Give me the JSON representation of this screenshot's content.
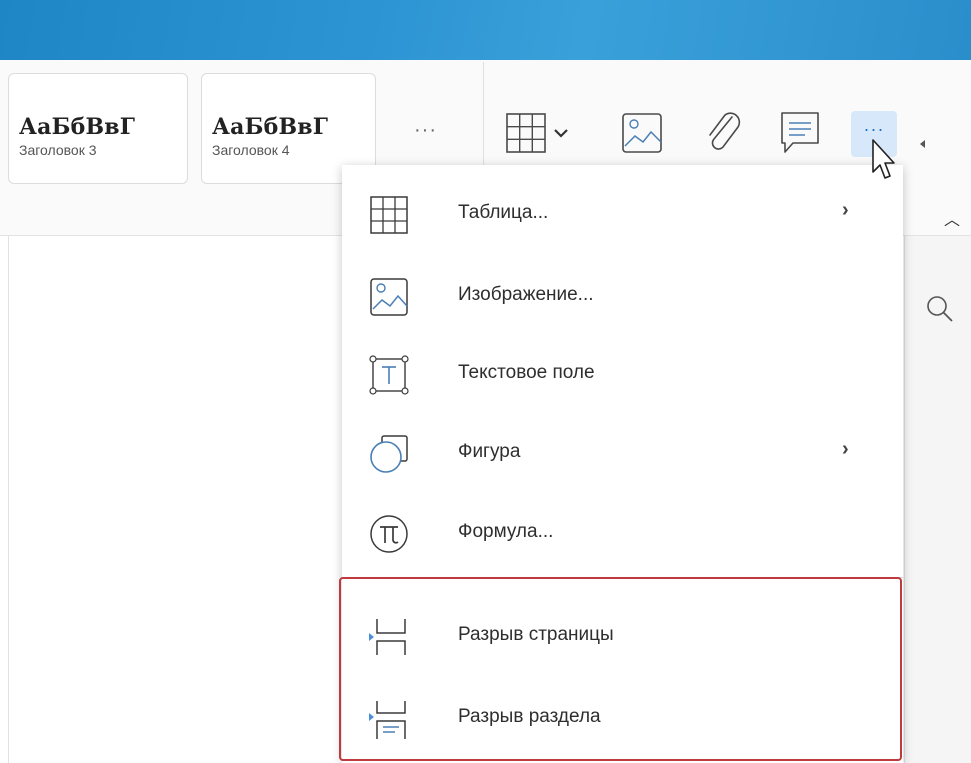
{
  "styles": [
    {
      "sample": "АаБбВвГ",
      "name": "Заголовок 3"
    },
    {
      "sample": "АаБбВвГ",
      "name": "Заголовок 4"
    }
  ],
  "toolbar": {
    "more_styles_label": "···",
    "more_label": "···",
    "icons": [
      "table-icon",
      "image-icon",
      "link-icon",
      "comment-icon",
      "more-icon"
    ]
  },
  "menu": {
    "items": [
      {
        "label": "Таблица...",
        "icon": "table-icon",
        "submenu": true
      },
      {
        "label": "Изображение...",
        "icon": "image-icon",
        "submenu": false
      },
      {
        "label": "Текстовое поле",
        "icon": "text-box-icon",
        "submenu": false
      },
      {
        "label": "Фигура",
        "icon": "shape-icon",
        "submenu": true
      },
      {
        "label": "Формула...",
        "icon": "formula-icon",
        "submenu": false
      },
      {
        "label": "Разрыв страницы",
        "icon": "page-break-icon",
        "submenu": false
      },
      {
        "label": "Разрыв раздела",
        "icon": "section-break-icon",
        "submenu": false
      }
    ],
    "submenu_arrow": "›"
  },
  "colors": {
    "accent": "#2d95d3",
    "highlight": "#c0393f",
    "icon": "#4a7fb5"
  }
}
